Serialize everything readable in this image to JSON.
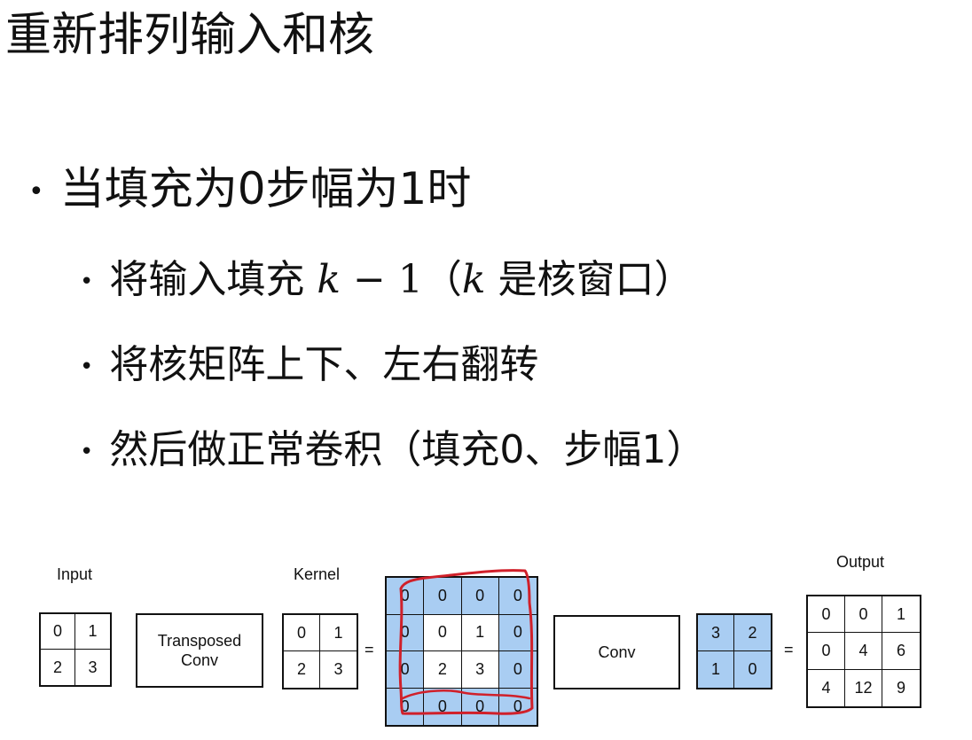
{
  "title": "重新排列输入和核",
  "bullet1": "当填充为0步幅为1时",
  "sub1": {
    "pre": "将输入填充 ",
    "math": "k",
    "minus": " − 1",
    "paren_open": "（",
    "k": "k",
    "rest": " 是核窗口）"
  },
  "sub2": "将核矩阵上下、左右翻转",
  "sub3": "然后做正常卷积（填充0、步幅1）",
  "diagram": {
    "input_label": "Input",
    "input": [
      [
        "0",
        "1"
      ],
      [
        "2",
        "3"
      ]
    ],
    "transposed_line1": "Transposed",
    "transposed_line2": "Conv",
    "kernel_label": "Kernel",
    "kernel": [
      [
        "0",
        "1"
      ],
      [
        "2",
        "3"
      ]
    ],
    "eq": "=",
    "padded": [
      [
        "0",
        "0",
        "0",
        "0"
      ],
      [
        "0",
        "0",
        "1",
        "0"
      ],
      [
        "0",
        "2",
        "3",
        "0"
      ],
      [
        "0",
        "0",
        "0",
        "0"
      ]
    ],
    "conv_label": "Conv",
    "flipped": [
      [
        "3",
        "2"
      ],
      [
        "1",
        "0"
      ]
    ],
    "output_label": "Output",
    "output": [
      [
        "0",
        "0",
        "1"
      ],
      [
        "0",
        "4",
        "6"
      ],
      [
        "4",
        "12",
        "9"
      ]
    ],
    "colors": {
      "highlight": "#a9cdf2",
      "annotation": "#d0202a"
    }
  }
}
